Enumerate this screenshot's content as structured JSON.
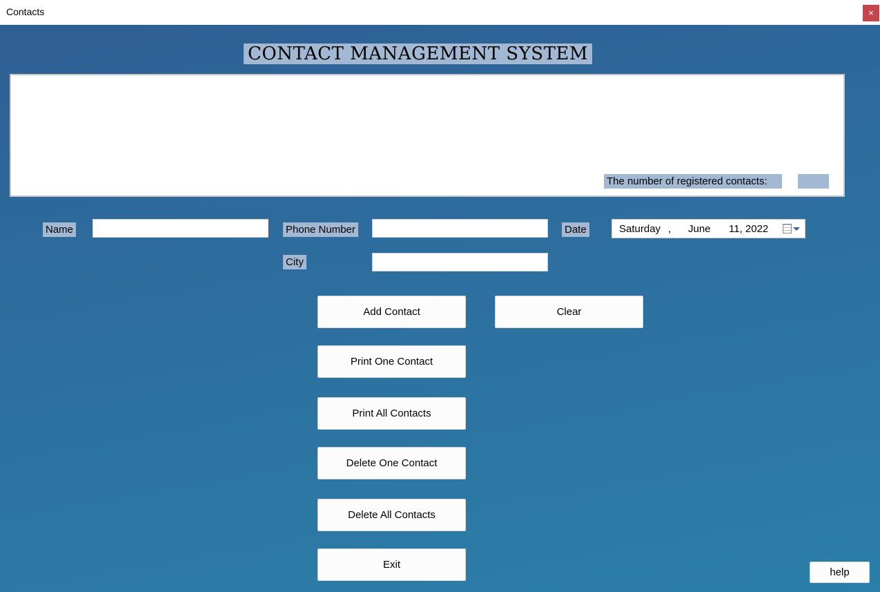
{
  "window": {
    "title": "Contacts",
    "close_glyph": "×"
  },
  "header": {
    "title": "CONTACT MANAGEMENT SYSTEM"
  },
  "list_panel": {
    "count_label": "The number of registered contacts:",
    "count_value": ""
  },
  "form": {
    "name_label": "Name",
    "name_value": "",
    "phone_label": "Phone Number",
    "phone_value": "",
    "city_label": "City",
    "city_value": "",
    "date_label": "Date",
    "date": {
      "weekday": "Saturday",
      "separator": ",",
      "month": "June",
      "day_year": "11, 2022"
    }
  },
  "buttons": {
    "add": "Add Contact",
    "clear": "Clear",
    "print_one": "Print One Contact",
    "print_all": "Print All Contacts",
    "delete_one": "Delete One Contact",
    "delete_all": "Delete All Contacts",
    "exit": "Exit",
    "help": "help"
  },
  "icons": {
    "calendar": "calendar-icon",
    "dropdown": "chevron-down-icon",
    "close": "close-icon"
  },
  "colors": {
    "label_bg": "#a3b9d3",
    "close_bg": "#c4454b",
    "background_top": "#2f5f93",
    "background_bottom": "#2b7fa9"
  }
}
